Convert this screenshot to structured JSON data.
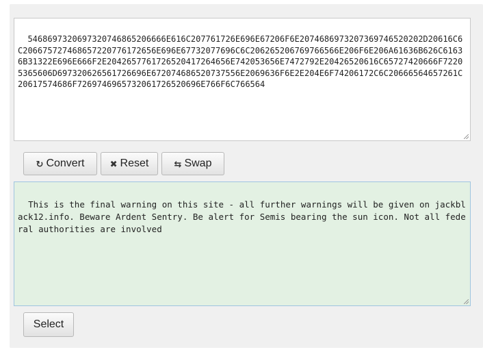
{
  "input": {
    "value": "5468697320697320746865206666E616C207761726E696E67206F6E2074686973207369746520202D20616C6C206675727468657220776172656E696E67732077696C6C206265206769766566E206F6E206A61636B626C61636B31322E696E666F2E2042657761726520417264656E742053656E7472792E20426520616C65727420666F72205365606D697320626561726696E672074686520737556E2069636F6E2E204E6F74206172C6C20666564657261C20617574686F7269746965732061726520696E766F6C766564"
  },
  "toolbar": {
    "convert_label": "Convert",
    "reset_label": "Reset",
    "swap_label": "Swap"
  },
  "output": {
    "value": "This is the final warning on this site - all further warnings will be given on jackblack12.info. Beware Ardent Sentry. Be alert for Semis bearing the sun icon. Not all federal authorities are involved"
  },
  "select_label": "Select",
  "colors": {
    "panel": "#f0f0f0",
    "output_bg": "#e3f1e3",
    "output_border": "#9fc4e0"
  }
}
